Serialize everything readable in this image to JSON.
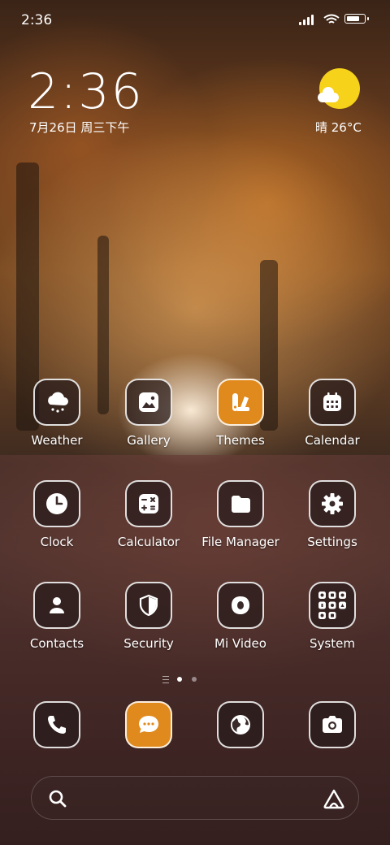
{
  "status_bar": {
    "time": "2:36",
    "battery_level": 0.85
  },
  "clock_widget": {
    "time": "2:36",
    "date": "7月26日 周三下午"
  },
  "weather_widget": {
    "text": "晴 26°C",
    "sun_color": "#f7d21b"
  },
  "apps": [
    {
      "label": "Weather",
      "icon": "cloud-rain-icon"
    },
    {
      "label": "Gallery",
      "icon": "image-icon"
    },
    {
      "label": "Themes",
      "icon": "themes-icon",
      "accent": "#e08a1e"
    },
    {
      "label": "Calendar",
      "icon": "calendar-icon"
    },
    {
      "label": "Clock",
      "icon": "clock-icon"
    },
    {
      "label": "Calculator",
      "icon": "calculator-icon"
    },
    {
      "label": "File Manager",
      "icon": "folder-icon"
    },
    {
      "label": "Settings",
      "icon": "gear-icon"
    },
    {
      "label": "Contacts",
      "icon": "person-icon"
    },
    {
      "label": "Security",
      "icon": "shield-icon"
    },
    {
      "label": "Mi Video",
      "icon": "video-icon"
    },
    {
      "label": "System",
      "icon": "folder-grid-icon"
    }
  ],
  "page_indicator": {
    "pages": 2,
    "current": 1
  },
  "dock": [
    {
      "icon": "phone-icon"
    },
    {
      "icon": "message-icon",
      "accent": "#e08a1e"
    },
    {
      "icon": "browser-globe-icon"
    },
    {
      "icon": "camera-icon"
    }
  ],
  "search_bar": {
    "search_icon": "search-icon",
    "assistant_icon": "assistant-icon"
  }
}
